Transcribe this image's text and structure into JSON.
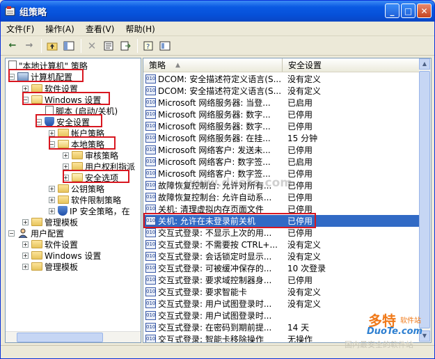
{
  "window": {
    "title": "组策略"
  },
  "menu": [
    "文件(F)",
    "操作(A)",
    "查看(V)",
    "帮助(H)"
  ],
  "toolbar": [
    "back-icon",
    "forward-icon",
    "up-icon",
    "show-tree-icon",
    "delete-icon",
    "properties-icon",
    "export-icon",
    "help-icon",
    "view-icon"
  ],
  "tree": {
    "root": "\"本地计算机\" 策略",
    "computer_config": "计算机配置",
    "software_settings": "软件设置",
    "windows_settings": "Windows 设置",
    "scripts": "脚本 (启动/关机)",
    "security_settings": "安全设置",
    "account_policy": "帐户策略",
    "local_policy": "本地策略",
    "audit_policy": "审核策略",
    "user_rights": "用户权利指派",
    "security_options": "安全选项",
    "public_key": "公钥策略",
    "software_restriction": "软件限制策略",
    "ip_security": "IP 安全策略，在",
    "admin_templates": "管理模板",
    "user_config": "用户配置",
    "user_software_settings": "软件设置",
    "user_windows_settings": "Windows 设置",
    "user_admin_templates": "管理模板"
  },
  "list": {
    "col_policy": "策略",
    "col_setting": "安全设置",
    "rows": [
      {
        "name": "DCOM: 安全描述符定义语言(S...",
        "setting": "没有定义"
      },
      {
        "name": "DCOM: 安全描述符定义语言(S...",
        "setting": "没有定义"
      },
      {
        "name": "Microsoft 网络服务器: 当登...",
        "setting": "已启用"
      },
      {
        "name": "Microsoft 网络服务器: 数字...",
        "setting": "已停用"
      },
      {
        "name": "Microsoft 网络服务器: 数字...",
        "setting": "已停用"
      },
      {
        "name": "Microsoft 网络服务器: 在挂...",
        "setting": "15 分钟"
      },
      {
        "name": "Microsoft 网络客户: 发送未...",
        "setting": "已停用"
      },
      {
        "name": "Microsoft 网络客户: 数字签...",
        "setting": "已启用"
      },
      {
        "name": "Microsoft 网络客户: 数字签...",
        "setting": "已停用"
      },
      {
        "name": "故障恢复控制台: 允许对所有...",
        "setting": "已停用"
      },
      {
        "name": "故障恢复控制台: 允许自动系...",
        "setting": "已停用"
      },
      {
        "name": "关机: 清理虚拟内存页面文件",
        "setting": "已停用"
      },
      {
        "name": "关机: 允许在未登录前关机",
        "setting": "已停用"
      },
      {
        "name": "交互式登录: 不显示上次的用...",
        "setting": "已停用"
      },
      {
        "name": "交互式登录: 不需要按 CTRL+...",
        "setting": "没有定义"
      },
      {
        "name": "交互式登录: 会话锁定时显示...",
        "setting": "没有定义"
      },
      {
        "name": "交互式登录: 可被缓冲保存的...",
        "setting": "10 次登录"
      },
      {
        "name": "交互式登录: 要求域控制器身...",
        "setting": "已停用"
      },
      {
        "name": "交互式登录: 要求智能卡",
        "setting": "没有定义"
      },
      {
        "name": "交互式登录: 用户试图登录时...",
        "setting": "没有定义"
      },
      {
        "name": "交互式登录: 用户试图登录时...",
        "setting": ""
      },
      {
        "name": "交互式登录: 在密码到期前提...",
        "setting": "14 天"
      },
      {
        "name": "交互式登录: 智能卡移除操作",
        "setting": "无操作"
      }
    ]
  },
  "watermark": {
    "center": "www.duote.com",
    "brand_top": "多特",
    "brand_sub": "软件站",
    "brand_url": "DuoTe.com",
    "brand_slogan": "国内最安全的软件站"
  }
}
